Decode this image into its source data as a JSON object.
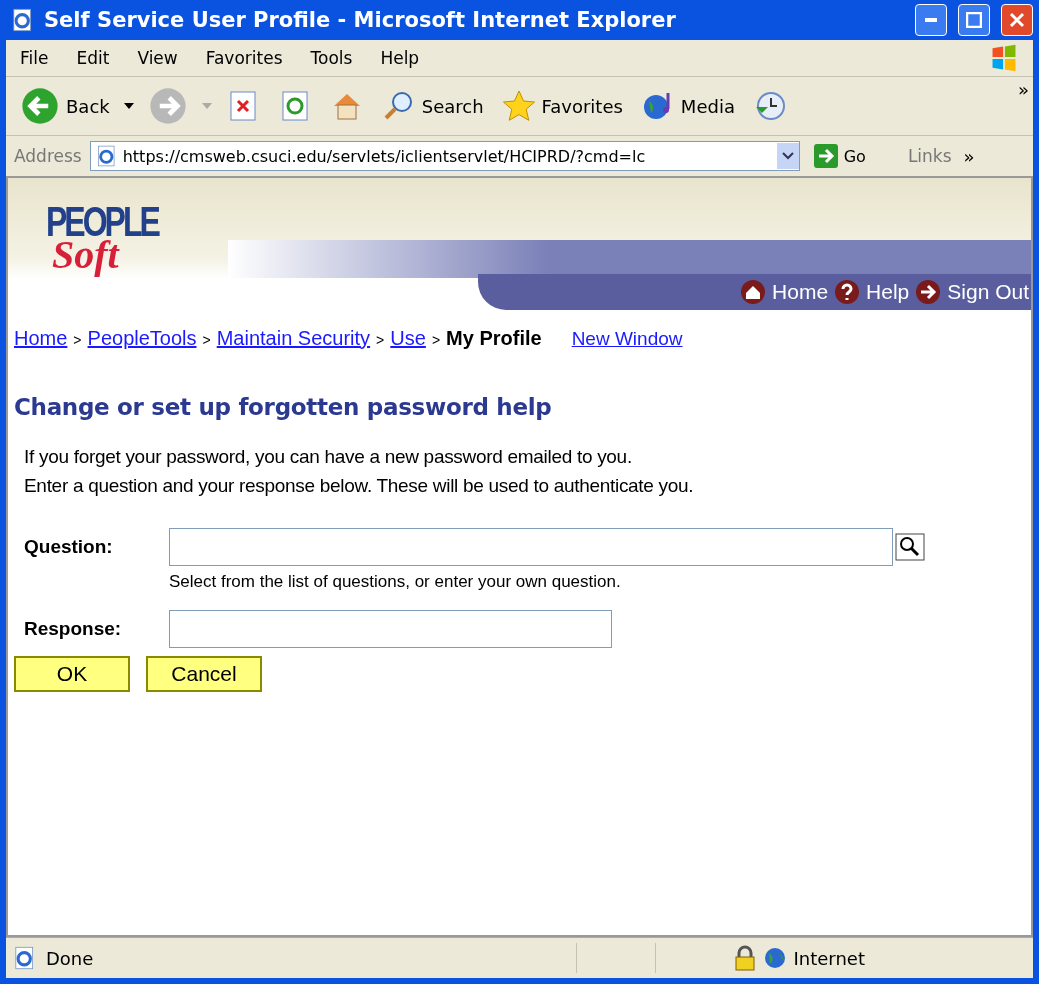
{
  "window": {
    "title": "Self Service User Profile - Microsoft Internet Explorer"
  },
  "menu": [
    "File",
    "Edit",
    "View",
    "Favorites",
    "Tools",
    "Help"
  ],
  "toolbar": [
    {
      "kind": "back",
      "label": "Back",
      "disabled": false
    },
    {
      "kind": "forward",
      "disabled": true
    },
    {
      "kind": "stop"
    },
    {
      "kind": "refresh"
    },
    {
      "kind": "home"
    },
    {
      "kind": "search",
      "label": "Search"
    },
    {
      "kind": "favorites",
      "label": "Favorites"
    },
    {
      "kind": "media",
      "label": "Media"
    },
    {
      "kind": "history"
    }
  ],
  "more": "»",
  "address": {
    "label": "Address",
    "url": "https://cmsweb.csuci.edu/servlets/iclientservlet/HCIPRD/?cmd=lc",
    "go": "Go",
    "links": "Links",
    "more": "»"
  },
  "logo": {
    "top": "PEOPLE",
    "bottom": "Soft"
  },
  "header_links": [
    {
      "kind": "home",
      "label": "Home"
    },
    {
      "kind": "help",
      "label": "Help"
    },
    {
      "kind": "signout",
      "label": "Sign Out"
    }
  ],
  "breadcrumb": {
    "separator": ">",
    "items": [
      {
        "kind": "link",
        "label": "Home"
      },
      {
        "kind": "link",
        "label": "PeopleTools"
      },
      {
        "kind": "link",
        "label": "Maintain Security"
      },
      {
        "kind": "link",
        "label": "Use"
      },
      {
        "kind": "current",
        "label": "My Profile"
      }
    ],
    "new_window": "New Window"
  },
  "heading": "Change or set up forgotten password help",
  "intro": [
    "If you forget your password, you can have a new password emailed to you.",
    "Enter a question and your response below. These will be used to authenticate you."
  ],
  "form": {
    "question": {
      "label": "Question:",
      "hint": "Select from the list of questions, or enter your own question."
    },
    "response": {
      "label": "Response:"
    }
  },
  "buttons": [
    "OK",
    "Cancel"
  ],
  "status_bar": {
    "text": "Done",
    "zone": "Internet"
  }
}
